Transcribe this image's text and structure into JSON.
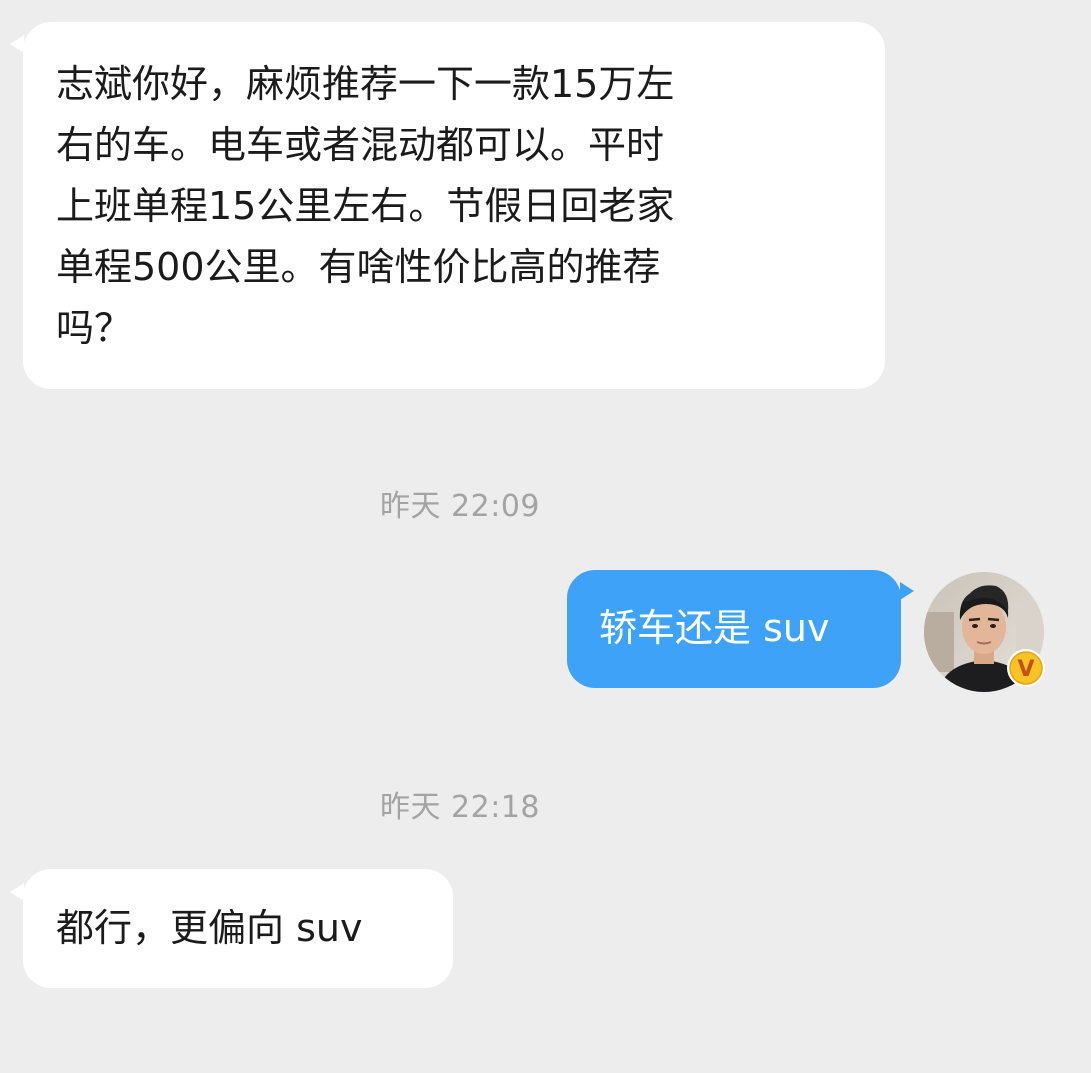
{
  "messages": [
    {
      "direction": "incoming",
      "lines": [
        "志斌你好，麻烦推荐一下一款15万左",
        "右的车。电车或者混动都可以。平时",
        "上班单程15公里左右。节假日回老家",
        "单程500公里。有啥性价比高的推荐",
        "吗？"
      ]
    },
    {
      "timestamp": "昨天 22:09"
    },
    {
      "direction": "outgoing",
      "text": "轿车还是 suv"
    },
    {
      "timestamp": "昨天 22:18"
    },
    {
      "direction": "incoming",
      "text": "都行，更偏向 suv"
    }
  ],
  "avatar": {
    "icon": "user-avatar-icon",
    "badge_icon": "verified-v-badge-icon",
    "badge_text": "V"
  },
  "colors": {
    "background": "#ededed",
    "incoming_bubble": "#ffffff",
    "outgoing_bubble": "#3ea3f8",
    "timestamp_text": "#a3a3a3",
    "badge": "#f7c325"
  }
}
